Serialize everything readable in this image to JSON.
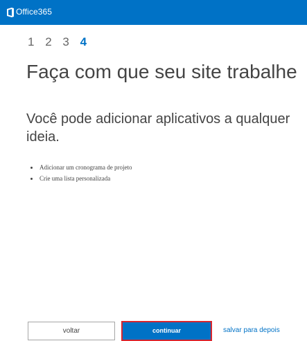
{
  "header": {
    "app_name": "Office365",
    "logo_icon": "office-logo-icon",
    "background": "#0072c6"
  },
  "steps": {
    "items": [
      "1",
      "2",
      "3",
      "4"
    ],
    "active": "4"
  },
  "main": {
    "title": "Faça com que seu site trabalhe",
    "description": "Você pode adicionar aplicativos a qualquer ideia.",
    "bullets": [
      "Adicionar um cronograma de projeto",
      "Crie uma lista personalizada"
    ]
  },
  "actions": {
    "back_label": "voltar",
    "continue_label": "continuar",
    "later_label": "salvar para depois",
    "accent": "#0072c6",
    "highlight": "#d9262e"
  }
}
